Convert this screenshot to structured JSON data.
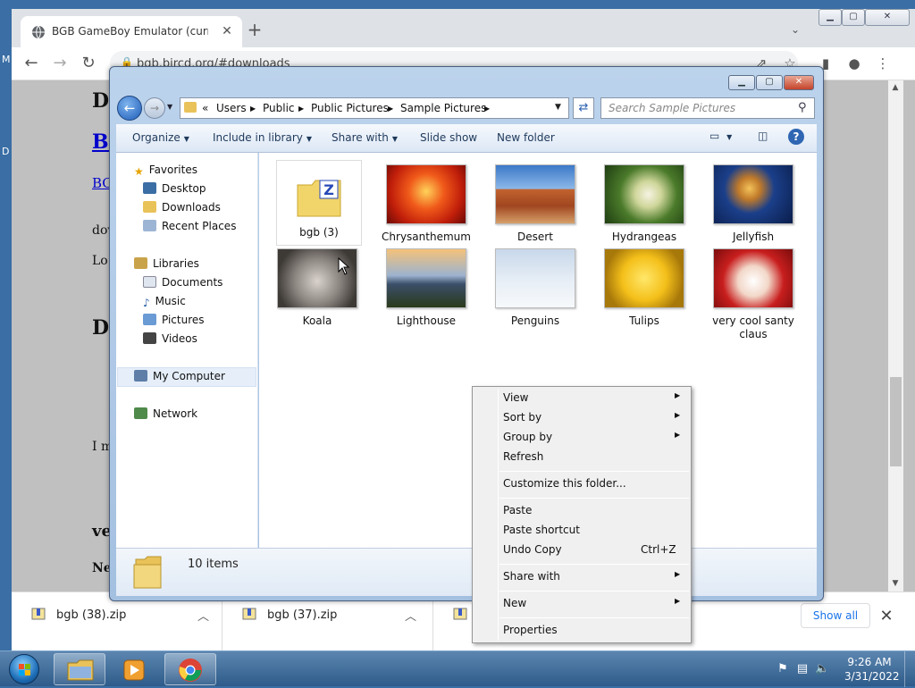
{
  "desktop": {
    "edge_letter_1": "M",
    "edge_letter_2": "D"
  },
  "browser": {
    "tab_title": "BGB GameBoy Emulator (current",
    "tab_close": "✕",
    "new_tab": "+",
    "url": "bgb.bircd.org/#downloads",
    "page_fragments": {
      "d1": "D",
      "bo": "Bo",
      "bol": "BO",
      "dov": "dov",
      "lo": "Lo",
      "d2": "D",
      "im": "I m",
      "ve": "ve",
      "ne": "Ne"
    }
  },
  "downloads_bar": {
    "items": [
      {
        "name": "bgb (38).zip"
      },
      {
        "name": "bgb (37).zip"
      }
    ],
    "show_all": "Show all"
  },
  "explorer": {
    "breadcrumb": [
      "«",
      "Users",
      "Public",
      "Public Pictures",
      "Sample Pictures"
    ],
    "search_placeholder": "Search Sample Pictures",
    "commands": {
      "organize": "Organize",
      "include": "Include in library",
      "share": "Share with",
      "slideshow": "Slide show",
      "newfolder": "New folder"
    },
    "nav": {
      "favorites": "Favorites",
      "desktop": "Desktop",
      "downloads": "Downloads",
      "recent": "Recent Places",
      "libraries": "Libraries",
      "documents": "Documents",
      "music": "Music",
      "pictures": "Pictures",
      "videos": "Videos",
      "mycomputer": "My Computer",
      "network": "Network"
    },
    "items": [
      {
        "label": "bgb (3)"
      },
      {
        "label": "Chrysanthemum"
      },
      {
        "label": "Desert"
      },
      {
        "label": "Hydrangeas"
      },
      {
        "label": "Jellyfish"
      },
      {
        "label": "Koala"
      },
      {
        "label": "Lighthouse"
      },
      {
        "label": "Penguins"
      },
      {
        "label": "Tulips"
      },
      {
        "label": "very cool santy claus"
      }
    ],
    "status": "10 items"
  },
  "context_menu": {
    "view": "View",
    "sortby": "Sort by",
    "groupby": "Group by",
    "refresh": "Refresh",
    "customize": "Customize this folder...",
    "paste": "Paste",
    "paste_shortcut": "Paste shortcut",
    "undo_copy": "Undo Copy",
    "undo_shortcut": "Ctrl+Z",
    "share_with": "Share with",
    "new": "New",
    "properties": "Properties"
  },
  "taskbar": {
    "time": "9:26 AM",
    "date": "3/31/2022"
  }
}
